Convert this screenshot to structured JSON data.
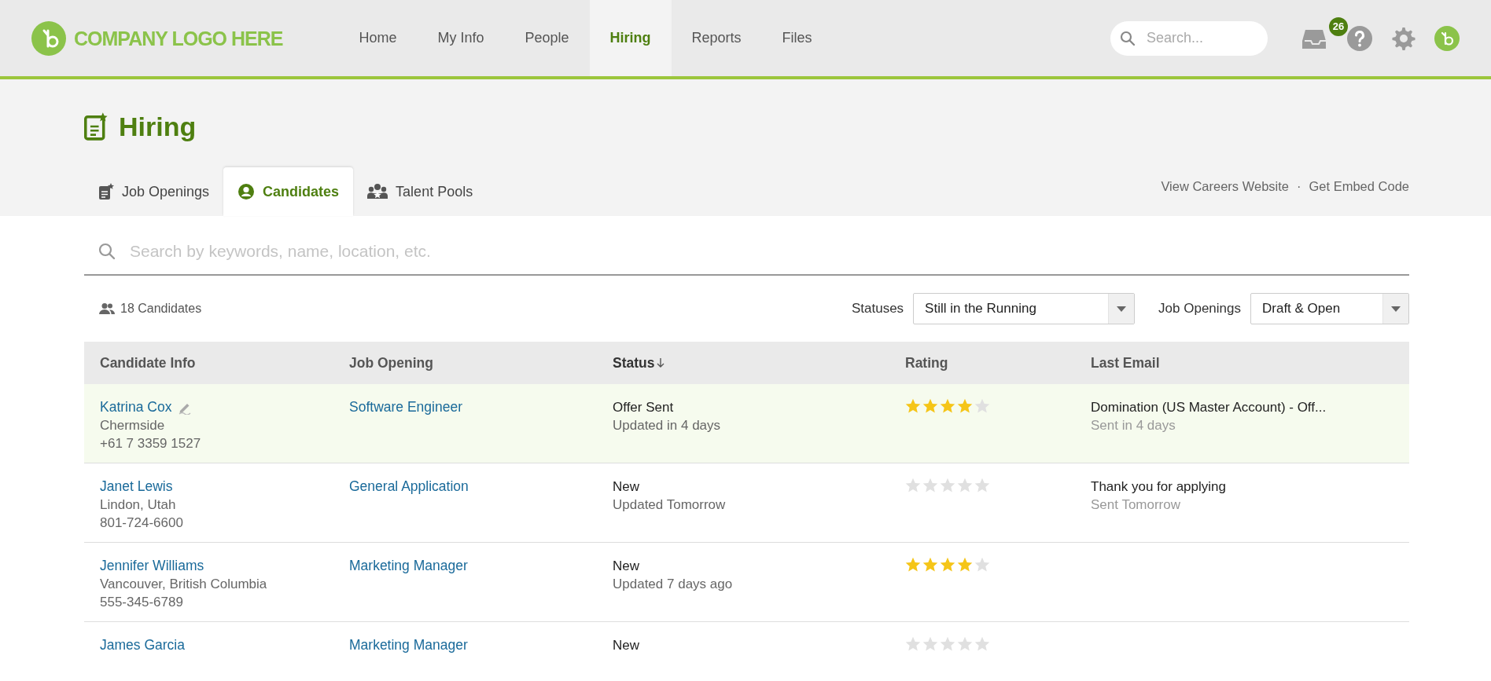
{
  "top_nav": {
    "logo_text": "COMPANY LOGO HERE",
    "items": [
      {
        "label": "Home",
        "selected": false
      },
      {
        "label": "My Info",
        "selected": false
      },
      {
        "label": "People",
        "selected": false
      },
      {
        "label": "Hiring",
        "selected": true
      },
      {
        "label": "Reports",
        "selected": false
      },
      {
        "label": "Files",
        "selected": false
      }
    ],
    "search": {
      "placeholder": "Search..."
    },
    "inbox_badge": "26"
  },
  "page": {
    "title": "Hiring",
    "tabs": [
      {
        "label": "Job Openings",
        "kind": "openings",
        "selected": false
      },
      {
        "label": "Candidates",
        "kind": "candidates",
        "selected": true
      },
      {
        "label": "Talent Pools",
        "kind": "pools",
        "selected": false
      }
    ],
    "links": [
      "View Careers Website",
      "Get Embed Code"
    ],
    "link_separator": "·"
  },
  "search": {
    "placeholder": "Search by keywords, name, location, etc."
  },
  "candidate_count": "18 Candidates",
  "filters": [
    {
      "label": "Statuses",
      "value": "Still in the Running"
    },
    {
      "label": "Job Openings",
      "value": "Draft & Open"
    }
  ],
  "table": {
    "columns": [
      {
        "label": "Candidate Info",
        "sorted": false
      },
      {
        "label": "Job Opening",
        "sorted": false
      },
      {
        "label": "Status",
        "sorted": true
      },
      {
        "label": "Rating",
        "sorted": false
      },
      {
        "label": "Last Email",
        "sorted": false
      }
    ],
    "rows": [
      {
        "name": "Katrina Cox",
        "signed": true,
        "location": "Chermside",
        "phone": "+61 7 3359 1527",
        "job": "Software Engineer",
        "status": "Offer Sent",
        "status_updated": "Updated in 4 days",
        "stars": 4,
        "email_subject": "Domination (US Master Account) - Off...",
        "email_sent": "Sent in 4 days",
        "selected": true
      },
      {
        "name": "Janet Lewis",
        "signed": false,
        "location": "Lindon, Utah",
        "phone": "801-724-6600",
        "job": "General Application",
        "status": "New",
        "status_updated": "Updated Tomorrow",
        "stars": 0,
        "email_subject": "Thank you for applying",
        "email_sent": "Sent Tomorrow",
        "selected": false
      },
      {
        "name": "Jennifer Williams",
        "signed": false,
        "location": "Vancouver, British Columbia",
        "phone": "555-345-6789",
        "job": "Marketing Manager",
        "status": "New",
        "status_updated": "Updated 7 days ago",
        "stars": 4,
        "selected": false
      },
      {
        "name": "James Garcia",
        "signed": false,
        "job": "Marketing Manager",
        "status": "New",
        "stars": 0,
        "selected": false
      }
    ]
  }
}
